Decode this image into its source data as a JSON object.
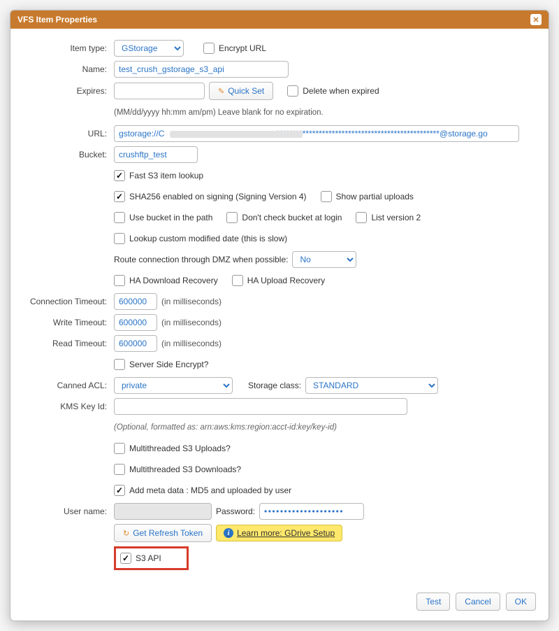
{
  "dialog": {
    "title": "VFS Item Properties"
  },
  "labels": {
    "item_type": "Item type:",
    "name": "Name:",
    "expires": "Expires:",
    "url": "URL:",
    "bucket": "Bucket:",
    "conn_to": "Connection Timeout:",
    "write_to": "Write Timeout:",
    "read_to": "Read Timeout:",
    "canned_acl": "Canned ACL:",
    "kms": "KMS Key Id:",
    "username": "User name:",
    "password": "Password:",
    "storage_class": "Storage class:"
  },
  "values": {
    "item_type": "GStorage",
    "name": "test_crush_gstorage_s3_api",
    "expires": "",
    "url": "gstorage://C                                               :**************************************************@storage.go",
    "bucket": "crushftp_test",
    "conn_to": "600000",
    "write_to": "600000",
    "read_to": "600000",
    "canned_acl": "private",
    "storage_class": "STANDARD",
    "kms": "",
    "username_masked": "",
    "password_masked": "••••••••••••••••••••",
    "dmz": "No"
  },
  "hints": {
    "expires_format": "(MM/dd/yyyy hh:mm am/pm) Leave blank for no expiration.",
    "kms_format": "(Optional, formatted as: arn:aws:kms:region:acct-id:key/key-id)",
    "ms": "(in milliseconds)"
  },
  "checks": {
    "encrypt_url": "Encrypt URL",
    "delete_expired": "Delete when expired",
    "fast_lookup": "Fast S3 item lookup",
    "sha256": "SHA256 enabled on signing (Signing Version 4)",
    "show_partial": "Show partial uploads",
    "bucket_in_path": "Use bucket in the path",
    "dont_check_bucket": "Don't check bucket at login",
    "list_v2": "List version 2",
    "lookup_custom_mod": "Lookup custom modified date (this is slow)",
    "dmz_label": "Route connection through DMZ when possible:",
    "ha_dl": "HA Download Recovery",
    "ha_ul": "HA Upload Recovery",
    "sse": "Server Side Encrypt?",
    "mt_upload": "Multithreaded S3 Uploads?",
    "mt_download": "Multithreaded S3 Downloads?",
    "add_meta": "Add meta data : MD5 and uploaded by user",
    "s3_api": "S3 API"
  },
  "buttons": {
    "quick_set": "Quick Set",
    "refresh_token": "Get Refresh Token",
    "learn_more": "Learn more: GDrive Setup",
    "test": "Test",
    "cancel": "Cancel",
    "ok": "OK"
  }
}
